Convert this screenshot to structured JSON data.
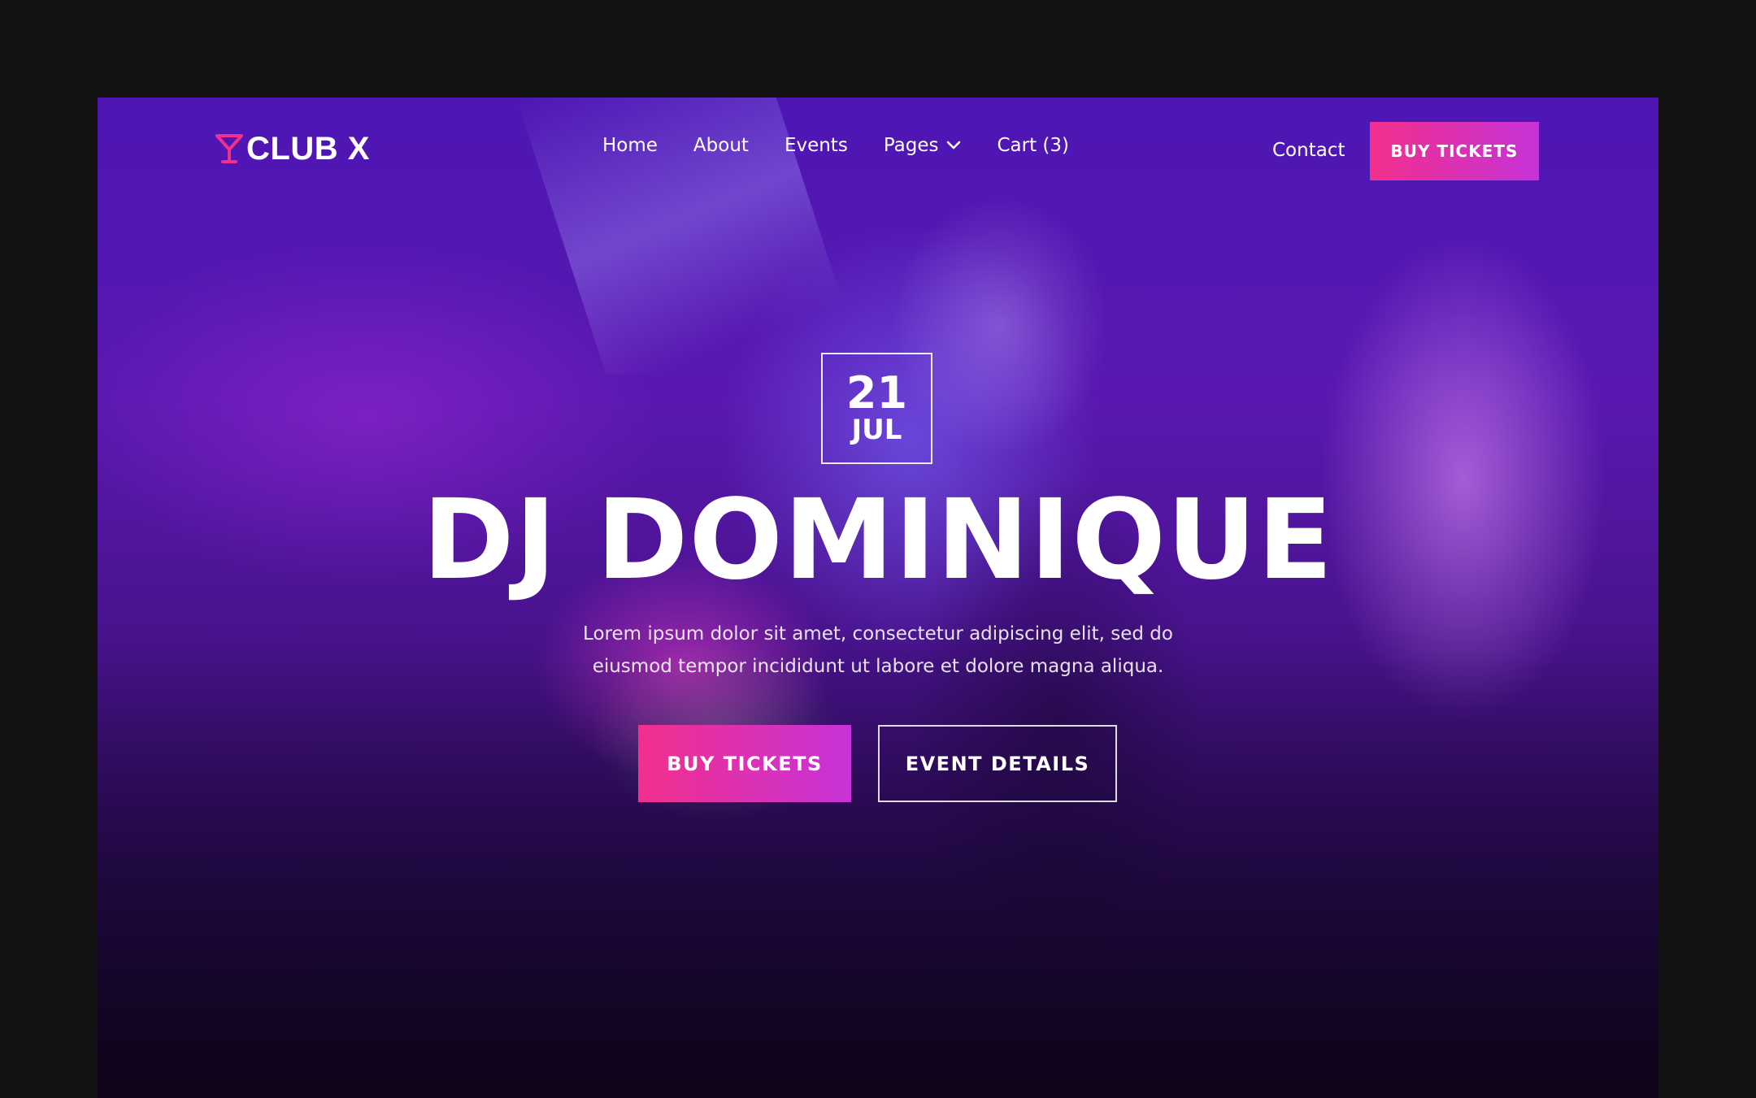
{
  "brand": {
    "name": "CLUB X",
    "logo_icon": "cocktail-glass-icon",
    "accent_color": "#f22f8c",
    "accent_color_end": "#c633d8"
  },
  "nav": {
    "items": [
      {
        "label": "Home"
      },
      {
        "label": "About"
      },
      {
        "label": "Events"
      },
      {
        "label": "Pages",
        "icon": "chevron-down-icon"
      },
      {
        "label": "Cart (3)"
      }
    ],
    "contact_label": "Contact",
    "buy_tickets_label": "BUY TICKETS"
  },
  "hero": {
    "date_day": "21",
    "date_month": "JUL",
    "title": "DJ DOMINIQUE",
    "description": "Lorem ipsum dolor sit amet, consectetur adipiscing elit, sed do eiusmod tempor incididunt ut labore et dolore magna aliqua.",
    "primary_button": "BUY TICKETS",
    "secondary_button": "EVENT DETAILS"
  }
}
